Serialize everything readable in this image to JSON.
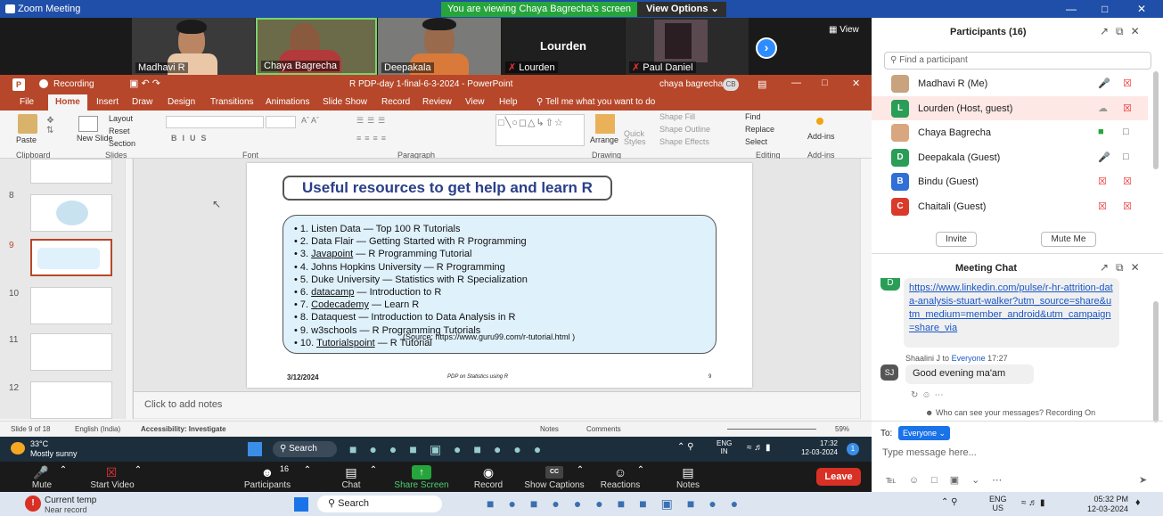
{
  "zoom": {
    "window_title": "Zoom Meeting",
    "viewing_banner": "You are viewing Chaya Bagrecha's screen",
    "view_options": "View Options",
    "view_btn": "View"
  },
  "video_tiles": [
    {
      "name": "Madhavi R"
    },
    {
      "name": "Chaya Bagrecha"
    },
    {
      "name": "Deepakala"
    },
    {
      "name": "Lourden",
      "center_name": "Lourden"
    },
    {
      "name": "Paul Daniel"
    }
  ],
  "ppt": {
    "title": "R PDP-day 1-final-6-3-2024  -  PowerPoint",
    "user": "chaya bagrecha",
    "user_initials": "CB",
    "recording": "Recording",
    "tabs": [
      "File",
      "Home",
      "Insert",
      "Draw",
      "Design",
      "Transitions",
      "Animations",
      "Slide Show",
      "Record",
      "Review",
      "View",
      "Help"
    ],
    "tell_me": "Tell me what you want to do",
    "ribbon": {
      "paste": "Paste",
      "layout": "Layout",
      "reset": "Reset",
      "new_slide": "New Slide",
      "section": "Section",
      "arrange": "Arrange",
      "quick_styles": "Quick Styles",
      "shape_fill": "Shape Fill",
      "shape_outline": "Shape Outline",
      "shape_effects": "Shape Effects",
      "find": "Find",
      "replace": "Replace",
      "select": "Select",
      "addins": "Add-ins",
      "groups": [
        "Clipboard",
        "Slides",
        "Font",
        "Paragraph",
        "Drawing",
        "Editing",
        "Add-ins"
      ]
    },
    "thumb_numbers": [
      "8",
      "9",
      "10",
      "11",
      "12"
    ],
    "slide": {
      "title": "Useful resources to get help and learn R",
      "resources": [
        {
          "bullet": "• 1. ",
          "name": "Listen Data",
          "rest": " — Top 100 R Tutorials",
          "underline": false
        },
        {
          "bullet": "• 2. ",
          "name": "Data Flair",
          "rest": " — Getting Started with R Programming",
          "underline": false
        },
        {
          "bullet": "• 3. ",
          "name": "Javapoint",
          "rest": " — R Programming Tutorial",
          "underline": true
        },
        {
          "bullet": "• 4. ",
          "name": "Johns Hopkins University",
          "rest": " — R Programming",
          "underline": false
        },
        {
          "bullet": "• 5. ",
          "name": "Duke University",
          "rest": " — Statistics with R Specialization",
          "underline": false
        },
        {
          "bullet": "• 6. ",
          "name": "datacamp",
          "rest": " — Introduction to R",
          "underline": true
        },
        {
          "bullet": "• 7. ",
          "name": "Codecademy",
          "rest": " — Learn R",
          "underline": true
        },
        {
          "bullet": "• 8. ",
          "name": "Dataquest",
          "rest": " — Introduction to Data Analysis in R",
          "underline": false
        },
        {
          "bullet": "• 9. ",
          "name": "w3schools",
          "rest": " — R Programming Tutorials",
          "underline": false
        },
        {
          "bullet": "• 10. ",
          "name": "Tutorialspoint",
          "rest": " — R Tutorial",
          "underline": true
        }
      ],
      "source": "(Source:  https://www.guru99.com/r-tutorial.html )",
      "date": "3/12/2024",
      "footer": "PDP on Statistics using R",
      "page": "9"
    },
    "notes_placeholder": "Click to add notes",
    "status": {
      "slide_of": "Slide 9 of 18",
      "language": "English (India)",
      "accessibility": "Accessibility: Investigate",
      "notes": "Notes",
      "comments": "Comments",
      "zoom": "59%"
    }
  },
  "share_taskbar": {
    "temp": "33°C",
    "weather": "Mostly sunny",
    "search": "Search",
    "lang": "ENG",
    "region": "IN",
    "time": "17:32",
    "date": "12-03-2024",
    "badge": "1"
  },
  "controls": [
    {
      "label": "Mute"
    },
    {
      "label": "Start Video"
    },
    {
      "label": "Participants",
      "count": "16"
    },
    {
      "label": "Chat"
    },
    {
      "label": "Share Screen"
    },
    {
      "label": "Record"
    },
    {
      "label": "Show Captions"
    },
    {
      "label": "Reactions"
    },
    {
      "label": "Notes"
    }
  ],
  "leave": "Leave",
  "participants": {
    "title": "Participants (16)",
    "search_placeholder": "Find a participant",
    "list": [
      {
        "name": "Madhavi R (Me)",
        "initial": "",
        "color": "#c9a27e"
      },
      {
        "name": "Lourden (Host, guest)",
        "initial": "L",
        "color": "#2a9d57"
      },
      {
        "name": "Chaya Bagrecha",
        "initial": "",
        "color": "#d9a77f"
      },
      {
        "name": "Deepakala (Guest)",
        "initial": "D",
        "color": "#2a9d57"
      },
      {
        "name": "Bindu (Guest)",
        "initial": "B",
        "color": "#2f6fd6"
      },
      {
        "name": "Chaitali (Guest)",
        "initial": "C",
        "color": "#d93a2b"
      }
    ],
    "invite": "Invite",
    "mute_me": "Mute Me"
  },
  "chat": {
    "title": "Meeting Chat",
    "msg1_initial": "D",
    "msg1_link": "https://www.linkedin.com/pulse/r-hr-attrition-data-analysis-stuart-walker?utm_source=share&utm_medium=member_android&utm_campaign=share_via",
    "msg2_sender": "Shaalini J",
    "msg2_to": "to",
    "msg2_target": "Everyone",
    "msg2_time": "17:27",
    "msg2_initials": "SJ",
    "msg2_text": "Good evening ma'am",
    "who_can_see": "Who can see your messages? Recording On",
    "to_label": "To:",
    "to_value": "Everyone",
    "input_placeholder": "Type message here..."
  },
  "host_taskbar": {
    "temp": "Current temp",
    "sub": "Near record",
    "search": "Search",
    "lang": "ENG",
    "region": "US",
    "time": "05:32 PM",
    "date": "12-03-2024"
  }
}
